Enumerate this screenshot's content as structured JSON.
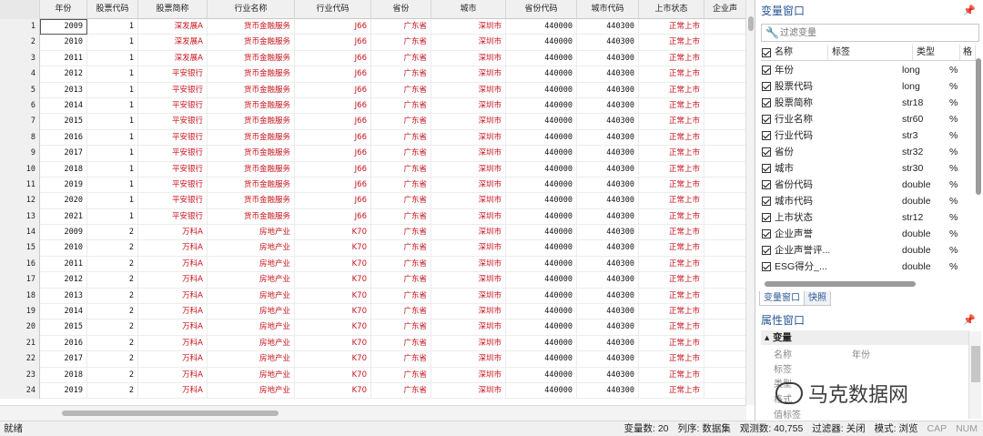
{
  "grid": {
    "columns": [
      {
        "label": "",
        "width": 44
      },
      {
        "label": "年份",
        "width": 52
      },
      {
        "label": "股票代码",
        "width": 56
      },
      {
        "label": "股票简称",
        "width": 76
      },
      {
        "label": "行业名称",
        "width": 96
      },
      {
        "label": "行业代码",
        "width": 84
      },
      {
        "label": "省份",
        "width": 66
      },
      {
        "label": "城市",
        "width": 82
      },
      {
        "label": "省份代码",
        "width": 78
      },
      {
        "label": "城市代码",
        "width": 68
      },
      {
        "label": "上市状态",
        "width": 72
      },
      {
        "label": "企业声",
        "width": 46
      }
    ],
    "rows": [
      [
        "1",
        "2009",
        "1",
        "深发展A",
        "货币金融服务",
        "J66",
        "广东省",
        "深圳市",
        "440000",
        "440300",
        "正常上市"
      ],
      [
        "2",
        "2010",
        "1",
        "深发展A",
        "货币金融服务",
        "J66",
        "广东省",
        "深圳市",
        "440000",
        "440300",
        "正常上市"
      ],
      [
        "3",
        "2011",
        "1",
        "深发展A",
        "货币金融服务",
        "J66",
        "广东省",
        "深圳市",
        "440000",
        "440300",
        "正常上市"
      ],
      [
        "4",
        "2012",
        "1",
        "平安银行",
        "货币金融服务",
        "J66",
        "广东省",
        "深圳市",
        "440000",
        "440300",
        "正常上市"
      ],
      [
        "5",
        "2013",
        "1",
        "平安银行",
        "货币金融服务",
        "J66",
        "广东省",
        "深圳市",
        "440000",
        "440300",
        "正常上市"
      ],
      [
        "6",
        "2014",
        "1",
        "平安银行",
        "货币金融服务",
        "J66",
        "广东省",
        "深圳市",
        "440000",
        "440300",
        "正常上市"
      ],
      [
        "7",
        "2015",
        "1",
        "平安银行",
        "货币金融服务",
        "J66",
        "广东省",
        "深圳市",
        "440000",
        "440300",
        "正常上市"
      ],
      [
        "8",
        "2016",
        "1",
        "平安银行",
        "货币金融服务",
        "J66",
        "广东省",
        "深圳市",
        "440000",
        "440300",
        "正常上市"
      ],
      [
        "9",
        "2017",
        "1",
        "平安银行",
        "货币金融服务",
        "J66",
        "广东省",
        "深圳市",
        "440000",
        "440300",
        "正常上市"
      ],
      [
        "10",
        "2018",
        "1",
        "平安银行",
        "货币金融服务",
        "J66",
        "广东省",
        "深圳市",
        "440000",
        "440300",
        "正常上市"
      ],
      [
        "11",
        "2019",
        "1",
        "平安银行",
        "货币金融服务",
        "J66",
        "广东省",
        "深圳市",
        "440000",
        "440300",
        "正常上市"
      ],
      [
        "12",
        "2020",
        "1",
        "平安银行",
        "货币金融服务",
        "J66",
        "广东省",
        "深圳市",
        "440000",
        "440300",
        "正常上市"
      ],
      [
        "13",
        "2021",
        "1",
        "平安银行",
        "货币金融服务",
        "J66",
        "广东省",
        "深圳市",
        "440000",
        "440300",
        "正常上市"
      ],
      [
        "14",
        "2009",
        "2",
        "万科A",
        "房地产业",
        "K70",
        "广东省",
        "深圳市",
        "440000",
        "440300",
        "正常上市"
      ],
      [
        "15",
        "2010",
        "2",
        "万科A",
        "房地产业",
        "K70",
        "广东省",
        "深圳市",
        "440000",
        "440300",
        "正常上市"
      ],
      [
        "16",
        "2011",
        "2",
        "万科A",
        "房地产业",
        "K70",
        "广东省",
        "深圳市",
        "440000",
        "440300",
        "正常上市"
      ],
      [
        "17",
        "2012",
        "2",
        "万科A",
        "房地产业",
        "K70",
        "广东省",
        "深圳市",
        "440000",
        "440300",
        "正常上市"
      ],
      [
        "18",
        "2013",
        "2",
        "万科A",
        "房地产业",
        "K70",
        "广东省",
        "深圳市",
        "440000",
        "440300",
        "正常上市"
      ],
      [
        "19",
        "2014",
        "2",
        "万科A",
        "房地产业",
        "K70",
        "广东省",
        "深圳市",
        "440000",
        "440300",
        "正常上市"
      ],
      [
        "20",
        "2015",
        "2",
        "万科A",
        "房地产业",
        "K70",
        "广东省",
        "深圳市",
        "440000",
        "440300",
        "正常上市"
      ],
      [
        "21",
        "2016",
        "2",
        "万科A",
        "房地产业",
        "K70",
        "广东省",
        "深圳市",
        "440000",
        "440300",
        "正常上市"
      ],
      [
        "22",
        "2017",
        "2",
        "万科A",
        "房地产业",
        "K70",
        "广东省",
        "深圳市",
        "440000",
        "440300",
        "正常上市"
      ],
      [
        "23",
        "2018",
        "2",
        "万科A",
        "房地产业",
        "K70",
        "广东省",
        "深圳市",
        "440000",
        "440300",
        "正常上市"
      ],
      [
        "24",
        "2019",
        "2",
        "万科A",
        "房地产业",
        "K70",
        "广东省",
        "深圳市",
        "440000",
        "440300",
        "正常上市"
      ]
    ]
  },
  "variables": {
    "title": "变量窗口",
    "filter_placeholder": "过滤变量",
    "header": {
      "name": "名称",
      "label": "标签",
      "type": "类型",
      "format": "格"
    },
    "items": [
      {
        "name": "年份",
        "type": "long",
        "format": "%"
      },
      {
        "name": "股票代码",
        "type": "long",
        "format": "%"
      },
      {
        "name": "股票简称",
        "type": "str18",
        "format": "%"
      },
      {
        "name": "行业名称",
        "type": "str60",
        "format": "%"
      },
      {
        "name": "行业代码",
        "type": "str3",
        "format": "%"
      },
      {
        "name": "省份",
        "type": "str32",
        "format": "%"
      },
      {
        "name": "城市",
        "type": "str30",
        "format": "%"
      },
      {
        "name": "省份代码",
        "type": "double",
        "format": "%"
      },
      {
        "name": "城市代码",
        "type": "double",
        "format": "%"
      },
      {
        "name": "上市状态",
        "type": "str12",
        "format": "%"
      },
      {
        "name": "企业声誉",
        "type": "double",
        "format": "%"
      },
      {
        "name": "企业声誉评...",
        "type": "double",
        "format": "%"
      },
      {
        "name": "ESG得分_...",
        "type": "double",
        "format": "%"
      }
    ],
    "tabs": [
      "变量窗口",
      "快照"
    ]
  },
  "properties": {
    "title": "属性窗口",
    "section": "变量",
    "rows": [
      {
        "key": "名称",
        "value": "年份"
      },
      {
        "key": "标签",
        "value": ""
      },
      {
        "key": "类型",
        "value": ""
      },
      {
        "key": "格式",
        "value": ""
      },
      {
        "key": "值标签",
        "value": ""
      }
    ]
  },
  "watermark": "马克数据网",
  "status": {
    "left": "就绪",
    "variables": "变量数: 20",
    "order": "列序: 数据集",
    "observations": "观测数: 40,755",
    "filter": "过滤器: 关闭",
    "mode": "模式: 浏览",
    "cap": "CAP",
    "num": "NUM"
  }
}
